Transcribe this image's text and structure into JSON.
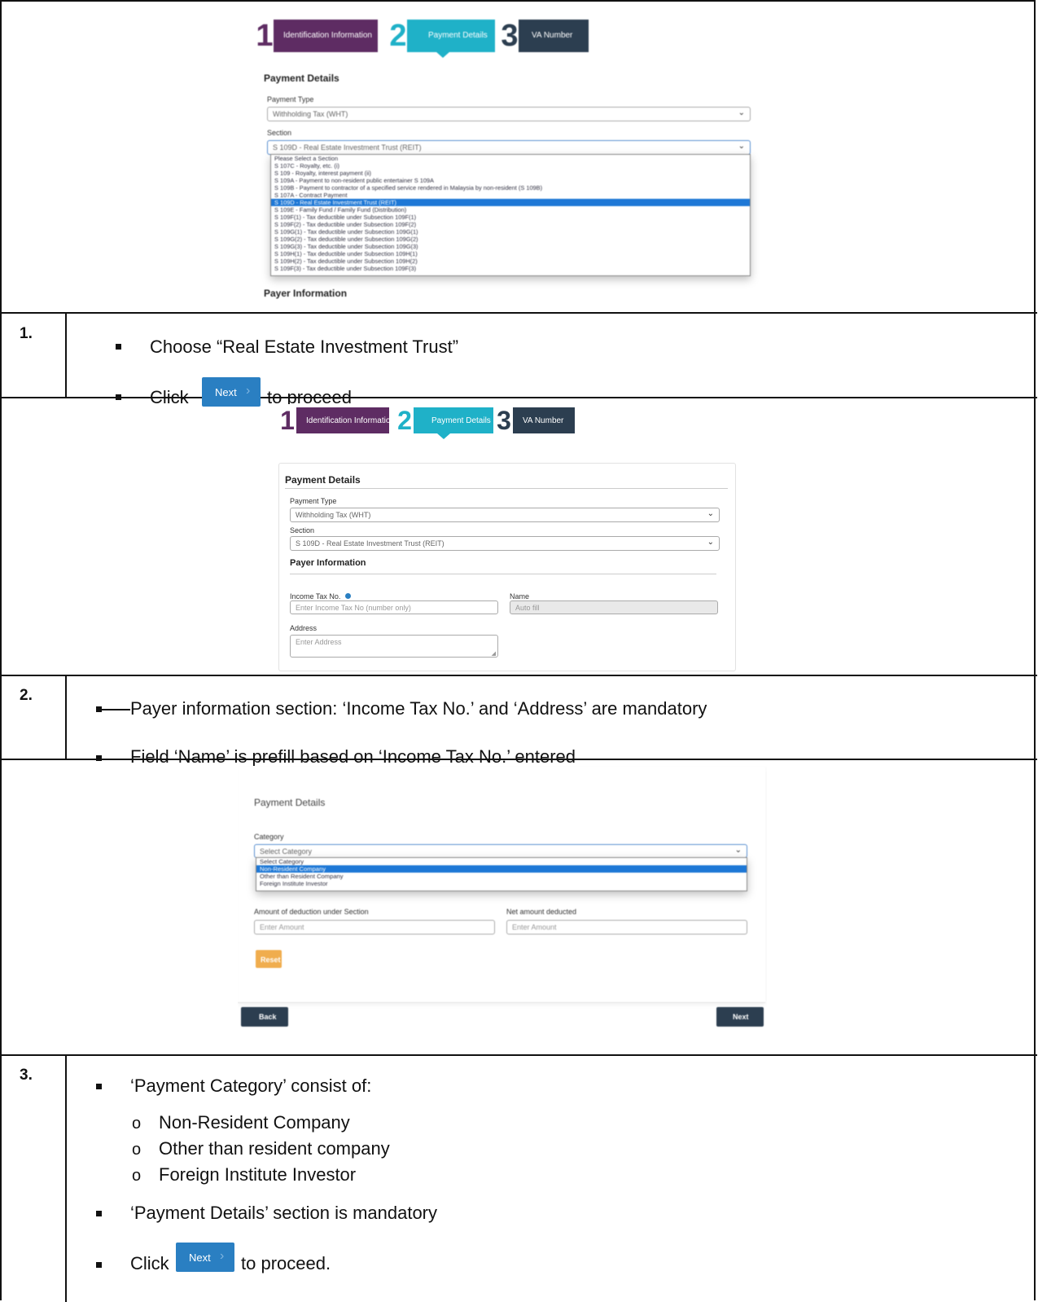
{
  "steps": [
    {
      "number": "1.",
      "bullets": [
        {
          "text": "Choose “Real Estate Investment Trust”"
        },
        {
          "prefix": "Click",
          "button_label": "Next",
          "suffix": "to proceed"
        }
      ]
    },
    {
      "number": "2.",
      "bullets": [
        {
          "text": "Payer information section: ‘Income Tax No.’ and ‘Address’ are mandatory"
        },
        {
          "text": "Field ‘Name’ is prefill based on ‘Income Tax No.’ entered"
        }
      ]
    },
    {
      "number": "3.",
      "bullets": [
        {
          "text": "‘Payment Category’ consist of:"
        },
        {
          "text": "‘Payment Details’ section is mandatory"
        },
        {
          "prefix": "Click",
          "button_label": "Next",
          "suffix": "to proceed."
        }
      ],
      "sub_bullets": [
        "Non-Resident Company",
        "Other than resident company",
        "Foreign Institute Investor"
      ],
      "sub_marker": "o"
    }
  ],
  "wizard": {
    "step1_num": "1",
    "step1_label": "Identification Information",
    "step2_num": "2",
    "step2_label": "Payment Details",
    "step3_num": "3",
    "step3_label": "VA Number"
  },
  "shot1": {
    "title": "Payment Details",
    "payment_type_label": "Payment Type",
    "payment_type_value": "Withholding Tax (WHT)",
    "section_label": "Section",
    "section_value": "S 109D - Real Estate Investment Trust (REIT)",
    "section_options": [
      "Please Select a Section",
      "S 107C - Royalty, etc. (i)",
      "S 109 - Royalty, interest payment (ii)",
      "S 109A - Payment to non-resident public entertainer S 109A",
      "S 109B - Payment to contractor of a specified service rendered in Malaysia by non-resident (S 109B)",
      "S 107A - Contract Payment",
      "S 109D - Real Estate Investment Trust (REIT)",
      "S 109E - Family Fund / Family Fund (Distribution)",
      "S 109F(1) - Tax deductible under Subsection 109F(1)",
      "S 109F(2) - Tax deductible under Subsection 109F(2)",
      "S 109G(1) - Tax deductible under Subsection 109G(1)",
      "S 109G(2) - Tax deductible under Subsection 109G(2)",
      "S 109G(3) - Tax deductible under Subsection 109G(3)",
      "S 109H(1) - Tax deductible under Subsection 109H(1)",
      "S 109H(2) - Tax deductible under Subsection 109H(2)",
      "S 109F(3) - Tax deductible under Subsection 109F(3)"
    ],
    "section_selected_index": 6,
    "next_heading": "Payer Information"
  },
  "shot2": {
    "title": "Payment Details",
    "payment_type_label": "Payment Type",
    "payment_type_value": "Withholding Tax (WHT)",
    "section_label": "Section",
    "section_value": "S 109D - Real Estate Investment Trust (REIT)",
    "payer_heading": "Payer Information",
    "itn_label": "Income Tax No.",
    "itn_placeholder": "Enter Income Tax No (number only)",
    "name_label": "Name",
    "name_value": "Auto fill",
    "address_label": "Address",
    "address_placeholder": "Enter Address"
  },
  "shot3": {
    "title": "Payment Details",
    "category_label": "Category",
    "category_value": "Select Category",
    "category_options": [
      "Select Category",
      "Non-Resident Company",
      "Other than Resident Company",
      "Foreign Institute Investor"
    ],
    "category_selected_index": 1,
    "amount_label": "Amount of deduction under Section",
    "amount_placeholder": "Enter Amount",
    "net_label": "Net amount deducted",
    "net_placeholder": "Enter Amount",
    "reset_label": "Reset",
    "back_label": "Back",
    "next_label": "Next"
  },
  "colors": {
    "wizard_purple": "#5e2c63",
    "wizard_teal": "#1fb1c8",
    "wizard_dark": "#2c3e50",
    "next_blue": "#2a7fc2",
    "selection_blue": "#1e78d6",
    "reset_orange": "#f0ad4e"
  }
}
